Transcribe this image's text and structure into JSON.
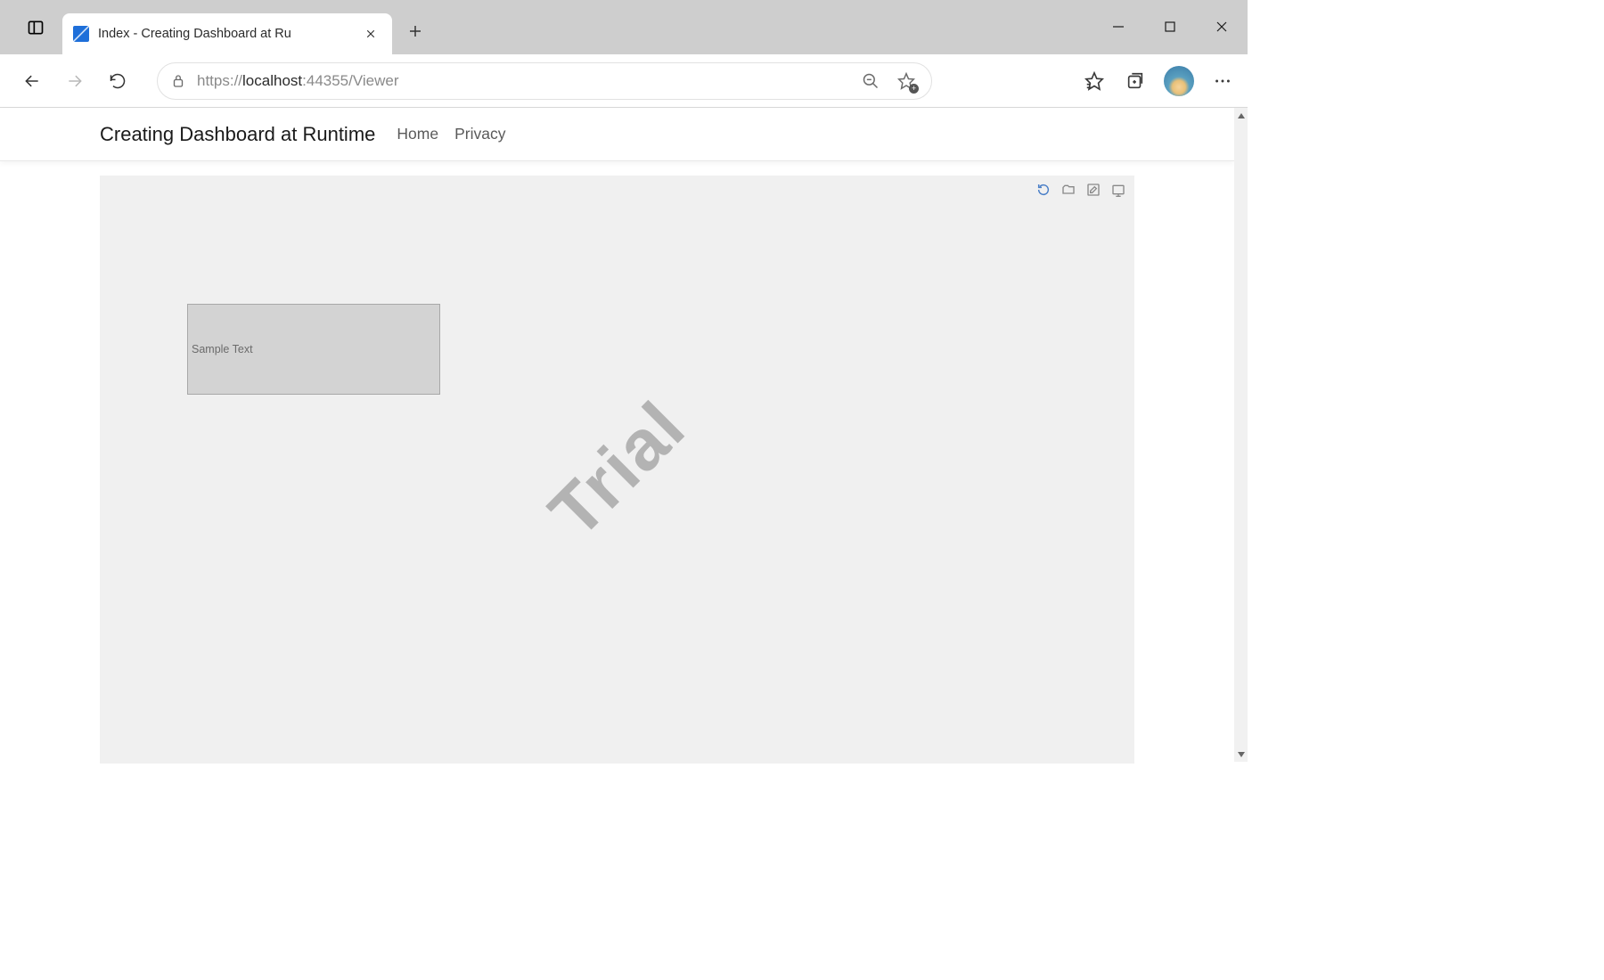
{
  "browser": {
    "tab_title": "Index - Creating Dashboard at Ru",
    "url_muted_prefix": "https://",
    "url_dark": "localhost",
    "url_muted_suffix": ":44355/Viewer"
  },
  "nav": {
    "app_title": "Creating Dashboard at Runtime",
    "links": [
      "Home",
      "Privacy"
    ]
  },
  "dashboard": {
    "widget_text": "Sample Text",
    "watermark": "Trial"
  }
}
